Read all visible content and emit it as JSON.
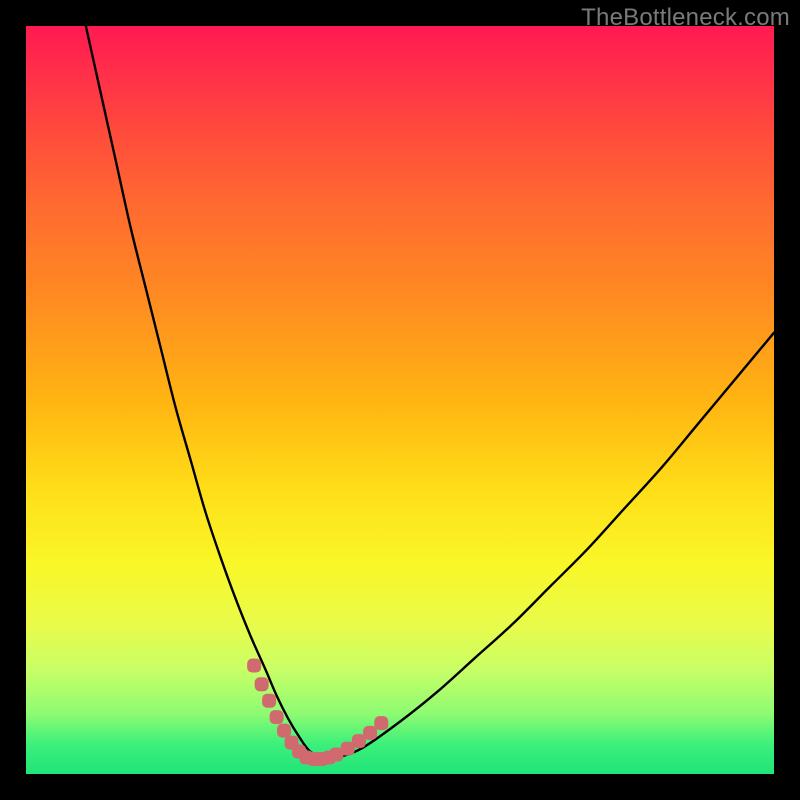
{
  "watermark": {
    "text": "TheBottleneck.com"
  },
  "colors": {
    "curve_stroke": "#000000",
    "marker_stroke": "#d16a6f",
    "marker_fill": "#d16a6f"
  },
  "chart_data": {
    "type": "line",
    "title": "",
    "xlabel": "",
    "ylabel": "",
    "xlim": [
      0,
      100
    ],
    "ylim": [
      0,
      100
    ],
    "grid": false,
    "legend": false,
    "series": [
      {
        "name": "bottleneck-curve",
        "x": [
          8,
          10,
          12,
          14,
          16,
          18,
          20,
          22,
          24,
          26,
          28,
          30,
          32,
          33.5,
          35,
          36.5,
          38,
          40,
          42,
          45,
          50,
          55,
          60,
          65,
          70,
          75,
          80,
          85,
          90,
          95,
          100
        ],
        "y": [
          100,
          91,
          82,
          73,
          65,
          57,
          49,
          42,
          35,
          29,
          23.5,
          18.5,
          14,
          10.5,
          7.5,
          5,
          3,
          2,
          2.3,
          3.5,
          7,
          11,
          15.5,
          20,
          25,
          30,
          35.5,
          41,
          47,
          53,
          59
        ]
      }
    ],
    "markers": {
      "name": "highlight-segment",
      "x": [
        30.5,
        31.5,
        32.5,
        33.5,
        34.5,
        35.5,
        36.5,
        37.5,
        38.5,
        39.5,
        40.5,
        41.5,
        43,
        44.5,
        46,
        47.5
      ],
      "y": [
        14.5,
        12,
        9.8,
        7.6,
        5.8,
        4.2,
        3,
        2.2,
        2,
        2,
        2.2,
        2.6,
        3.4,
        4.4,
        5.5,
        6.8
      ]
    }
  }
}
